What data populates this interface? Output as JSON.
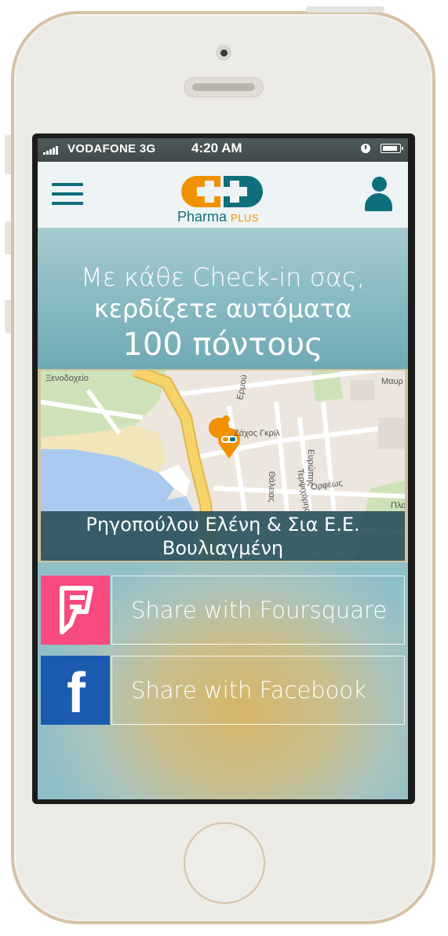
{
  "statusbar": {
    "carrier": "VODAFONE",
    "network": "3G",
    "time": "4:20 AM"
  },
  "header": {
    "logo_name": "Pharma",
    "logo_plus": "PLUS"
  },
  "promo": {
    "line1": "Με κάθε Check-in σας,",
    "line2": "κερδίζετε αυτόματα",
    "points": "100 πόντους"
  },
  "map": {
    "labels": [
      "Ξενοδοχείο",
      "Ζάχος Γκριλ",
      "Ερμού",
      "Ευρώπης",
      "Θάλειας",
      "Τερψιχόρης",
      "Ορφέως",
      "Μαυρ",
      "Πλα"
    ],
    "store_name": "Ρηγοπούλου Ελένη & Σια Ε.Ε.",
    "store_area": "Βουλιαγμένη"
  },
  "share": {
    "foursquare_label": "Share with Foursquare",
    "facebook_label": "Share with Facebook"
  },
  "colors": {
    "brand_teal": "#0f6f7c",
    "brand_orange": "#f29100",
    "foursquare": "#f74a7e",
    "facebook": "#1b5bb0"
  }
}
